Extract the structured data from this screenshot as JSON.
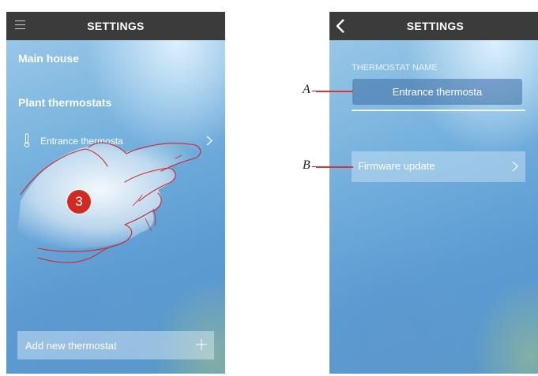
{
  "left_screen": {
    "title": "SETTINGS",
    "section_house": "Main house",
    "section_plant": "Plant thermostats",
    "thermostat_row": "Entrance thermosta",
    "step_number": "3",
    "add_button": "Add new thermostat"
  },
  "right_screen": {
    "title": "SETTINGS",
    "field_label": "THERMOSTAT NAME",
    "field_value": "Entrance thermosta",
    "firmware_button": "Firmware update"
  },
  "callouts": {
    "a": "A",
    "b": "B"
  },
  "colors": {
    "topbar": "#3b3b3b",
    "badge": "#d02a25",
    "callout_line": "#e03030"
  },
  "icons": [
    "menu-icon",
    "back-icon",
    "thermometer-icon",
    "chevron-right-icon",
    "plus-icon",
    "hand-pointer-illustration"
  ]
}
